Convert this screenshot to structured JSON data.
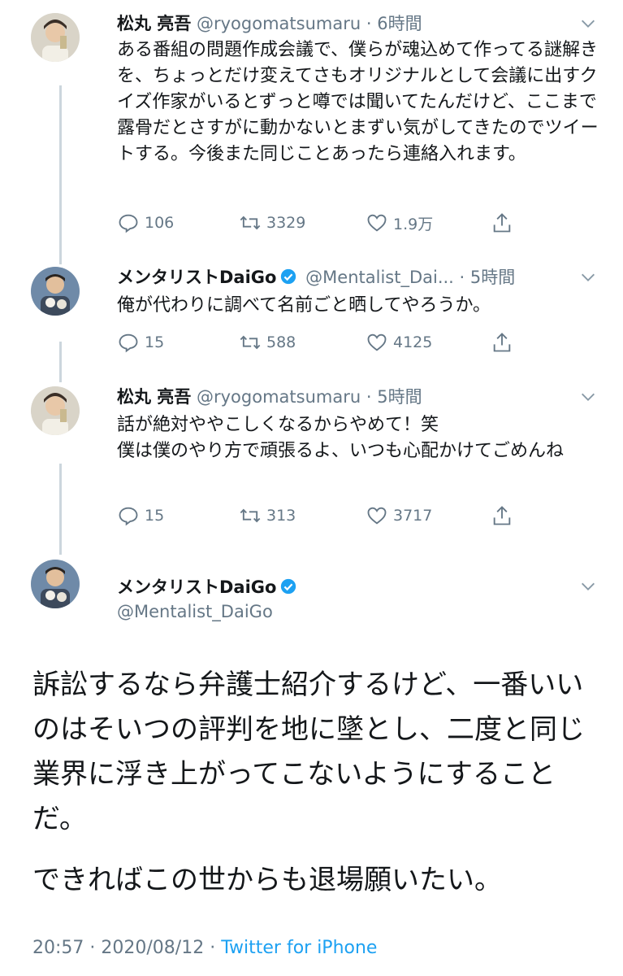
{
  "tweets": [
    {
      "name": "松丸 亮吾",
      "handle": "@ryogomatsumaru",
      "sep": "·",
      "time": "6時間",
      "text": "ある番組の問題作成会議で、僕らが魂込めて作ってる謎解きを、ちょっとだけ変えてさもオリジナルとして会議に出すクイズ作家がいるとずっと噂では聞いてたんだけど、ここまで露骨だとさすがに動かないとまずい気がしてきたのでツイートする。今後また同じことあったら連絡入れます。",
      "replies": "106",
      "retweets": "3329",
      "likes": "1.9万"
    },
    {
      "name": "メンタリストDaiGo",
      "handle": "@Mentalist_Dai...",
      "sep": "·",
      "time": "5時間",
      "text": "俺が代わりに調べて名前ごと晒してやろうか。",
      "replies": "15",
      "retweets": "588",
      "likes": "4125"
    },
    {
      "name": "松丸 亮吾",
      "handle": "@ryogomatsumaru",
      "sep": "·",
      "time": "5時間",
      "text": "話が絶対ややこしくなるからやめて！笑\n僕は僕のやり方で頑張るよ、いつも心配かけてごめんね",
      "replies": "15",
      "retweets": "313",
      "likes": "3717"
    }
  ],
  "main": {
    "name": "メンタリストDaiGo",
    "handle": "@Mentalist_DaiGo",
    "paragraph1": "訴訟するなら弁護士紹介するけど、一番いいのはそいつの評判を地に墜とし、二度と同じ業界に浮き上がってこないようにすることだ。",
    "paragraph2": "できればこの世からも退場願いたい。",
    "time": "20:57",
    "sep": "·",
    "date": "2020/08/12",
    "source": "Twitter for iPhone"
  },
  "colors": {
    "text": "#14171a",
    "muted": "#657786",
    "verified": "#1da1f2",
    "thread_line": "#ccd6dd",
    "link": "#1da1f2"
  },
  "icons": [
    "reply-icon",
    "retweet-icon",
    "like-icon",
    "share-icon",
    "caret-down-icon",
    "verified-badge-icon"
  ]
}
